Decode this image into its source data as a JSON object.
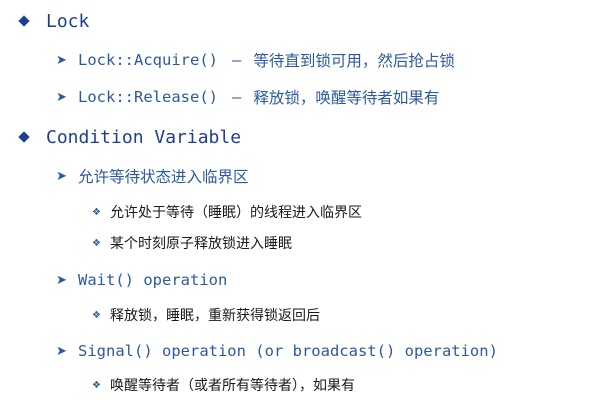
{
  "bullets": {
    "diamond": "diamond-bullet-icon",
    "arrow": "➤",
    "star": "❖"
  },
  "items": [
    {
      "level": 1,
      "text": "Lock"
    },
    {
      "level": 2,
      "code": "Lock::Acquire()",
      "dash": "–",
      "desc": "等待直到锁可用，然后抢占锁"
    },
    {
      "level": 2,
      "code": "Lock::Release()",
      "dash": "–",
      "desc": "释放锁，唤醒等待者如果有"
    },
    {
      "level": 1,
      "text": "Condition Variable"
    },
    {
      "level": 2,
      "desc": "允许等待状态进入临界区"
    },
    {
      "level": 3,
      "desc": "允许处于等待（睡眠）的线程进入临界区"
    },
    {
      "level": 3,
      "desc": "某个时刻原子释放锁进入睡眠"
    },
    {
      "level": 2,
      "code": "Wait() operation"
    },
    {
      "level": 3,
      "desc": "释放锁，睡眠，重新获得锁返回后"
    },
    {
      "level": 2,
      "code": "Signal() operation (or broadcast() operation)"
    },
    {
      "level": 3,
      "desc": "唤醒等待者（或者所有等待者），如果有"
    }
  ]
}
